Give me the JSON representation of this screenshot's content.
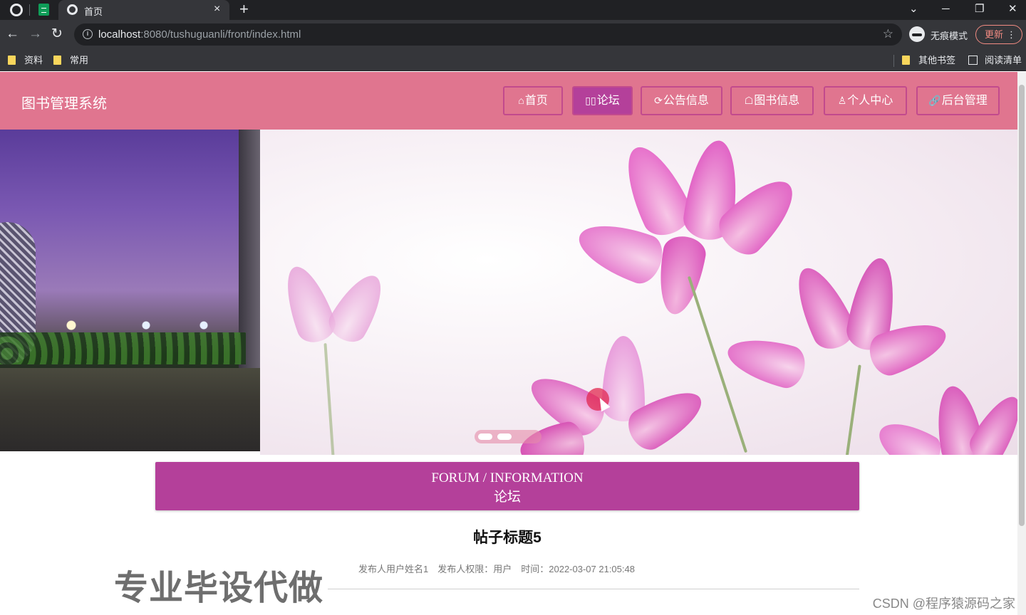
{
  "browser": {
    "tab_title": "首页",
    "tab_close": "×",
    "new_tab": "+",
    "url_host": "localhost",
    "url_path": ":8080/tushuguanli/front/index.html",
    "incognito_label": "无痕模式",
    "update_label": "更新",
    "update_menu": "⋮",
    "back": "←",
    "forward": "→",
    "reload": "↻",
    "star": "☆",
    "win_dropdown": "⌄",
    "win_minimize": "─",
    "win_restore": "❐",
    "win_close": "✕"
  },
  "bookmarks": {
    "left": [
      "资料",
      "常用"
    ],
    "other": "其他书签",
    "reading_list": "阅读清单"
  },
  "site": {
    "title": "图书管理系统",
    "nav": [
      {
        "icon": "⌂",
        "label": "首页"
      },
      {
        "icon": "▯▯",
        "label": "论坛"
      },
      {
        "icon": "⟳",
        "label": "公告信息"
      },
      {
        "icon": "☖",
        "label": "图书信息"
      },
      {
        "icon": "♙",
        "label": "个人中心"
      },
      {
        "icon": "🔗",
        "label": "后台管理"
      }
    ],
    "active_nav": 1,
    "colors": {
      "header": "#e0758f",
      "accent": "#b4409a"
    }
  },
  "carousel": {
    "slides": 3,
    "active_slide": 1
  },
  "section": {
    "en": "FORUM / INFORMATION",
    "cn": "论坛"
  },
  "post": {
    "title": "帖子标题5",
    "author": "发布人用户姓名1",
    "role": "发布人权限：用户",
    "time": "时间：2022-03-07 21:05:48"
  },
  "overlay": {
    "watermark": "专业毕设代做",
    "csdn": "CSDN @程序猿源码之家"
  }
}
